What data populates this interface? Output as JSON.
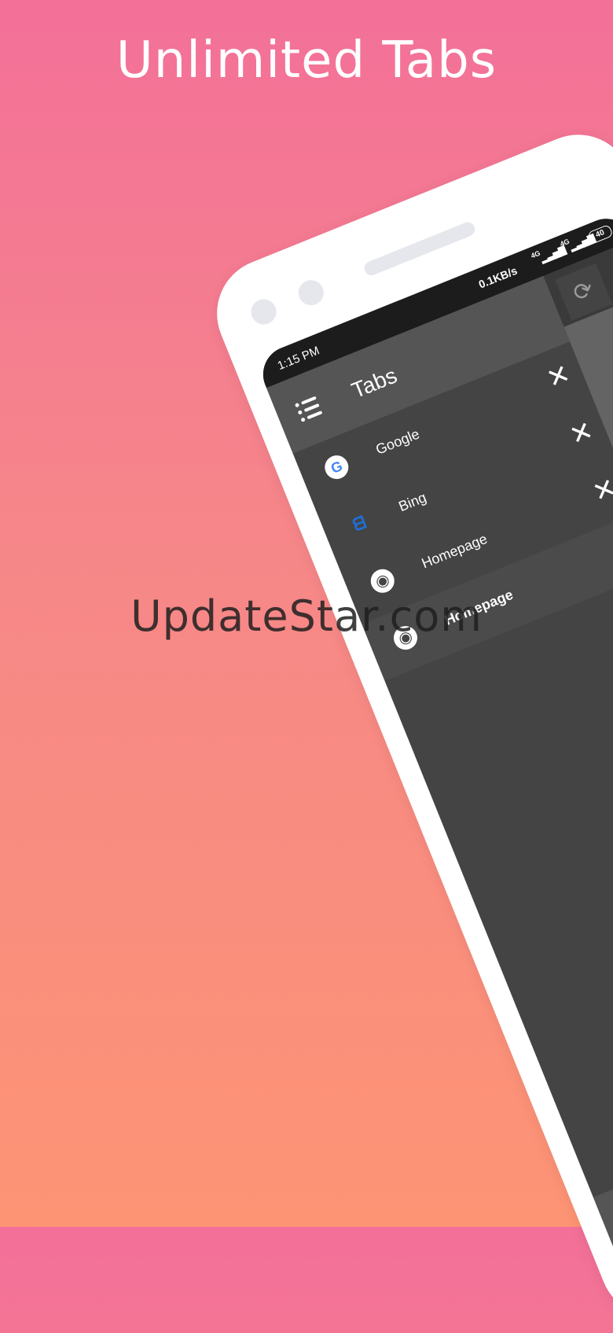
{
  "headline": "Unlimited Tabs",
  "status_bar": {
    "time": "1:15 PM",
    "speed": "0.1KB/s",
    "network_1": "4G",
    "network_2": "4G",
    "battery": "40"
  },
  "drawer": {
    "title": "Tabs",
    "tabs": [
      {
        "label": "Google",
        "favicon": "google-icon",
        "close": "✕"
      },
      {
        "label": "Bing",
        "favicon": "bing-icon",
        "close": "✕"
      },
      {
        "label": "Homepage",
        "favicon": "globe-icon",
        "close": "✕"
      },
      {
        "label": "Homepage",
        "favicon": "globe-icon",
        "close": ""
      }
    ]
  },
  "watermark": "UpdateStar.com",
  "colors": {
    "background_top": "#f37099",
    "background_bottom": "#fd9474",
    "drawer_bg": "#444444",
    "header_bg": "#555555"
  }
}
